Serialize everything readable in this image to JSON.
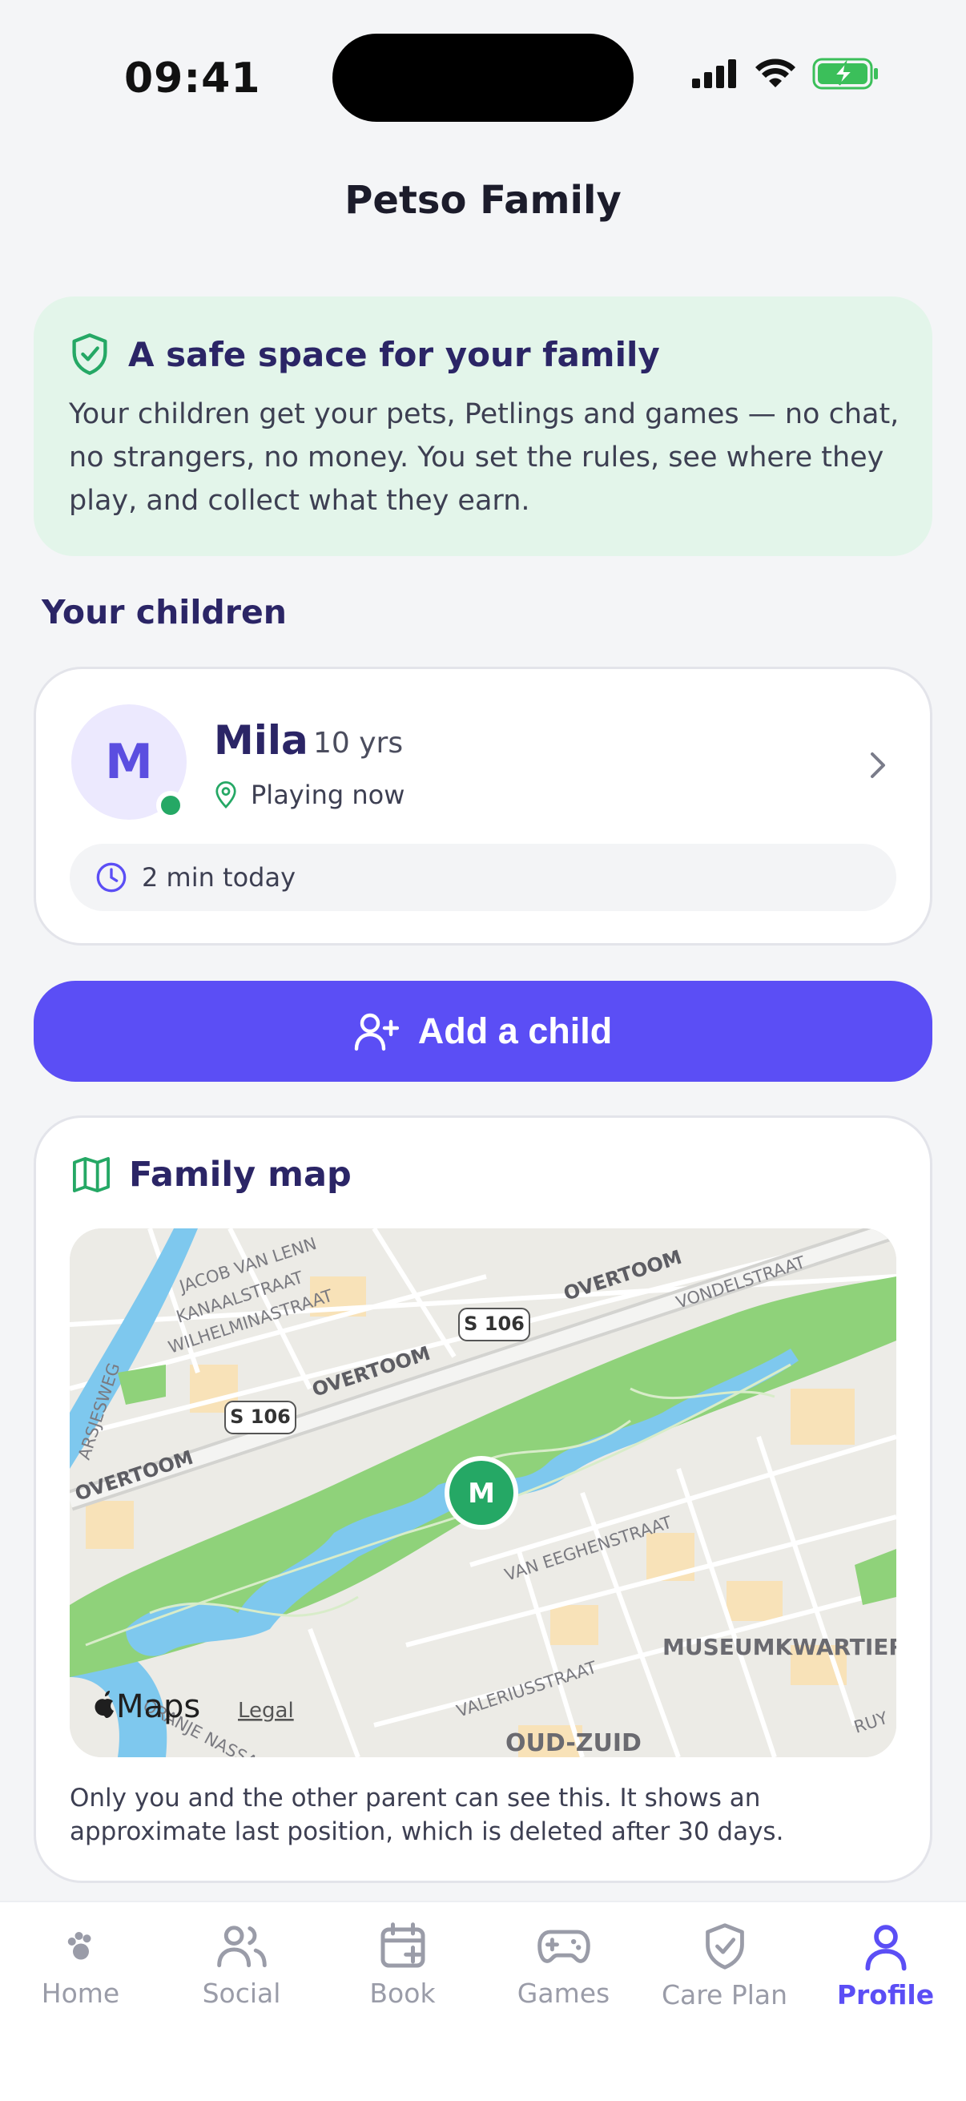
{
  "status_bar": {
    "time": "09:41"
  },
  "header": {
    "title": "Petso Family"
  },
  "safe_card": {
    "title": "A safe space for your family",
    "text": "Your children get your pets, Petlings and games — no chat, no strangers, no money. You set the rules, see where they play, and collect what they earn."
  },
  "children_section": {
    "title": "Your children"
  },
  "child": {
    "initial": "M",
    "name": "Mila",
    "age": "10 yrs",
    "status": "Playing now",
    "today": "2 min today"
  },
  "add_child": {
    "label": "Add a child"
  },
  "family_map": {
    "title": "Family map",
    "marker_initial": "M",
    "labels": {
      "overtoom": "OVERTOOM",
      "s106": "S 106",
      "vondelstraat": "VONDELSTRAAT",
      "jacob": "JACOB VAN LENN",
      "kanaalstraat": "KANAALSTRAAT",
      "wilhelmina": "WILHELMINASTRAAT",
      "sesjesweg": "ARSJESWEG",
      "eeghen": "VAN EEGHENSTRAAT",
      "valerius": "VALERIUSSTRAAT",
      "oranje": "ORANJE NASSAULAAN",
      "museum": "MUSEUMKWARTIER",
      "oudzuid": "OUD-ZUID",
      "ruy": "RUY"
    },
    "attribution": {
      "maps": "Maps",
      "legal": "Legal"
    },
    "note": "Only you and the other parent can see this. It shows an approximate last position, which is deleted after 30 days."
  },
  "tabs": [
    {
      "label": "Home",
      "icon": "paw-icon"
    },
    {
      "label": "Social",
      "icon": "users-icon"
    },
    {
      "label": "Book",
      "icon": "calendar-plus-icon"
    },
    {
      "label": "Games",
      "icon": "gamepad-icon"
    },
    {
      "label": "Care Plan",
      "icon": "shield-check-icon"
    },
    {
      "label": "Profile",
      "icon": "user-icon",
      "active": true
    }
  ],
  "colors": {
    "primary": "#5b4ef5",
    "heading": "#2b2566",
    "safe_bg": "#e3f5ea",
    "success": "#25a865"
  }
}
